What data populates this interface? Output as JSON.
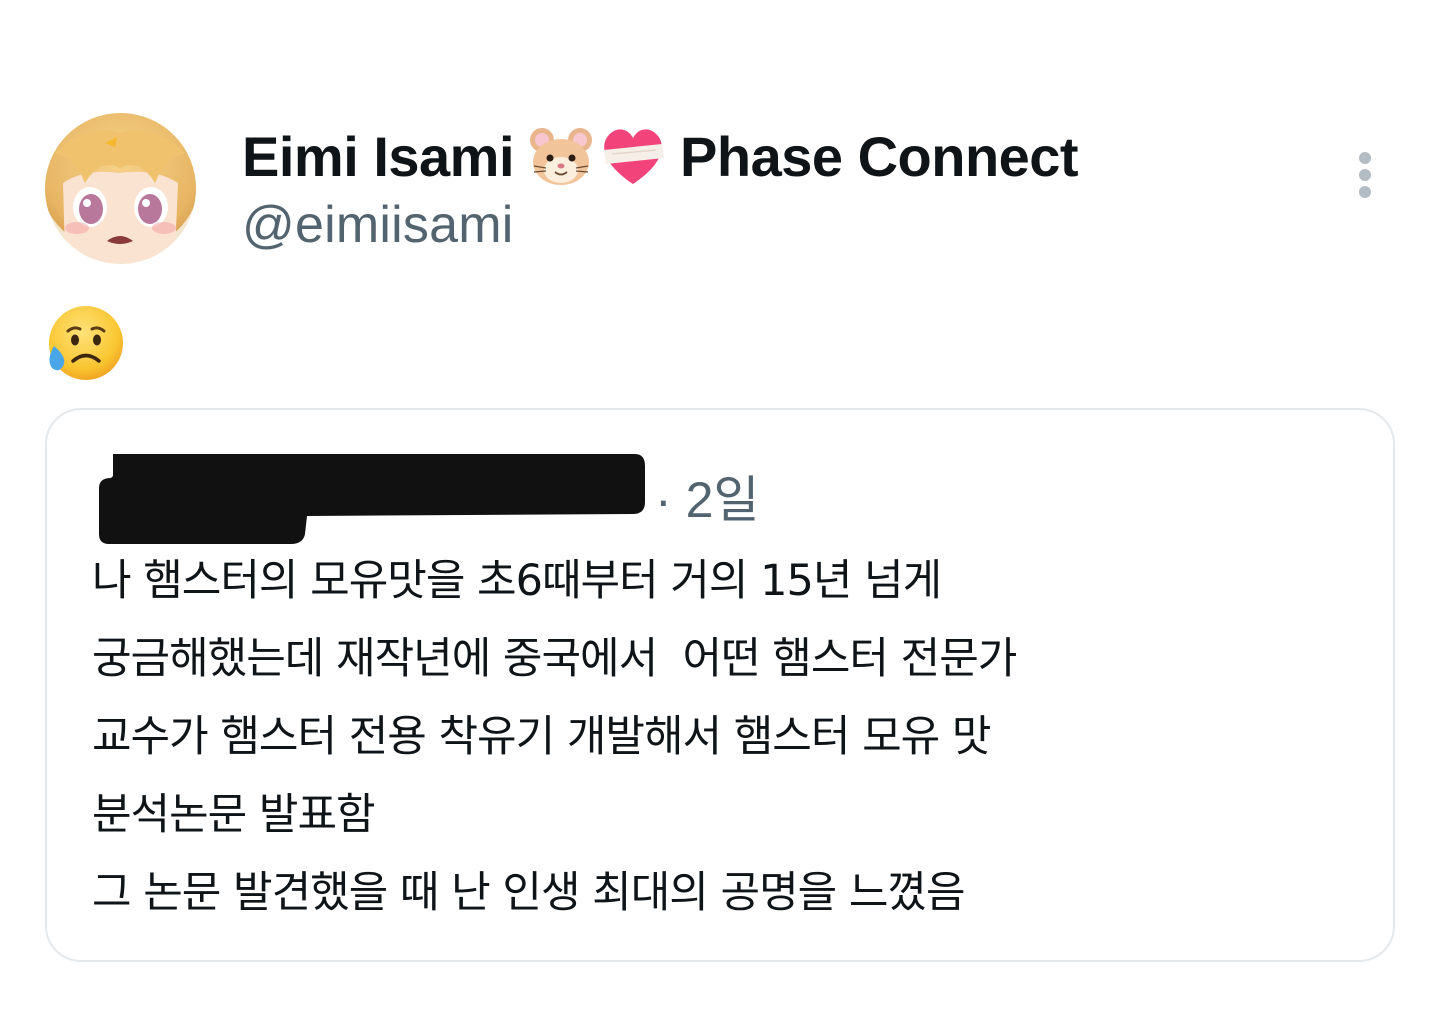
{
  "tweet": {
    "author": {
      "display_name": "Eimi Isami",
      "name_emojis": [
        "hamster-face-emoji",
        "mending-heart-emoji"
      ],
      "affiliation": "Phase Connect",
      "handle": "@eimiisami",
      "avatar": "anime-girl-avatar"
    },
    "more_icon": "more-vertical-icon",
    "body_emoji": "sad-but-relieved-face-emoji",
    "quoted": {
      "author_redacted": true,
      "separator": "·",
      "time": "2일",
      "text_lines": [
        "나 햄스터의 모유맛을 초6때부터 거의 15년 넘게",
        "궁금해했는데 재작년에 중국에서  어떤 햄스터 전문가",
        "교수가 햄스터 전용 착유기 개발해서 햄스터 모유 맛",
        "분석논문 발표함",
        "그 논문 발견했을 때 난 인생 최대의 공명을 느꼈음"
      ]
    }
  },
  "colors": {
    "text_primary": "#0f1419",
    "text_secondary": "#536471",
    "border": "#e4e8eb",
    "redaction": "#111111"
  }
}
